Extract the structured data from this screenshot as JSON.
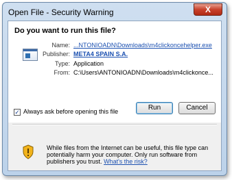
{
  "window": {
    "title": "Open File - Security Warning",
    "close_label": "X"
  },
  "question": "Do you want to run this file?",
  "file_info": {
    "name_key": "Name:",
    "name_value": "...NTONIOADN\\Downloads\\m4clickoncehelper.exe",
    "publisher_key": "Publisher:",
    "publisher_value": "META4 SPAIN S.A.",
    "type_key": "Type:",
    "type_value": "Application",
    "from_key": "From:",
    "from_value": "C:\\Users\\ANTONIOADN\\Downloads\\m4clickonce..."
  },
  "buttons": {
    "run": "Run",
    "cancel": "Cancel"
  },
  "checkbox": {
    "label": "Always ask before opening this file",
    "checked": true
  },
  "warning": {
    "text": "While files from the Internet can be useful, this file type can potentially harm your computer. Only run software from publishers you trust.",
    "link": "What's the risk?"
  }
}
